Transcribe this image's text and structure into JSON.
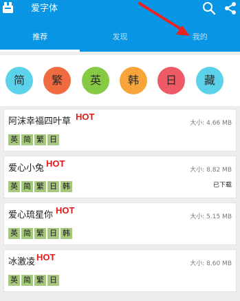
{
  "app": {
    "title": "爱字体",
    "icon": "app-logo-icon",
    "actions": [
      "search-icon",
      "share-icon"
    ]
  },
  "tabs": [
    {
      "label": "推荐",
      "active": true
    },
    {
      "label": "发现",
      "active": false
    },
    {
      "label": "我的",
      "active": false
    }
  ],
  "filters": [
    {
      "label": "简",
      "color": "#5bd1ea"
    },
    {
      "label": "繁",
      "color": "#f06b3f"
    },
    {
      "label": "英",
      "color": "#86c943"
    },
    {
      "label": "韩",
      "color": "#f7a43b"
    },
    {
      "label": "日",
      "color": "#ee5a66"
    },
    {
      "label": "藏",
      "color": "#5bd1ea"
    }
  ],
  "hot_label": "HOT",
  "fonts": [
    {
      "name": "阿沫幸福四叶草",
      "hot": true,
      "tags": [
        "英",
        "简",
        "繁",
        "日"
      ],
      "size": "大小: 4.66 MB",
      "status": ""
    },
    {
      "name": "爱心小兔",
      "hot": true,
      "tags": [
        "英",
        "简",
        "繁",
        "日",
        "韩"
      ],
      "size": "大小: 8.82 MB",
      "status": "已下载"
    },
    {
      "name": "爱心琉星你",
      "hot": true,
      "tags": [
        "英",
        "简",
        "繁",
        "日",
        "韩"
      ],
      "size": "大小: 5.15 MB",
      "status": ""
    },
    {
      "name": "冰激凌",
      "hot": true,
      "tags": [
        "英",
        "简",
        "繁",
        "日"
      ],
      "size": "大小: 8.60 MB",
      "status": ""
    }
  ],
  "colors": {
    "primary": "#0895e3",
    "hot": "#e01818",
    "tag": "#a6c97e",
    "annotation_arrow": "#e8231f"
  }
}
